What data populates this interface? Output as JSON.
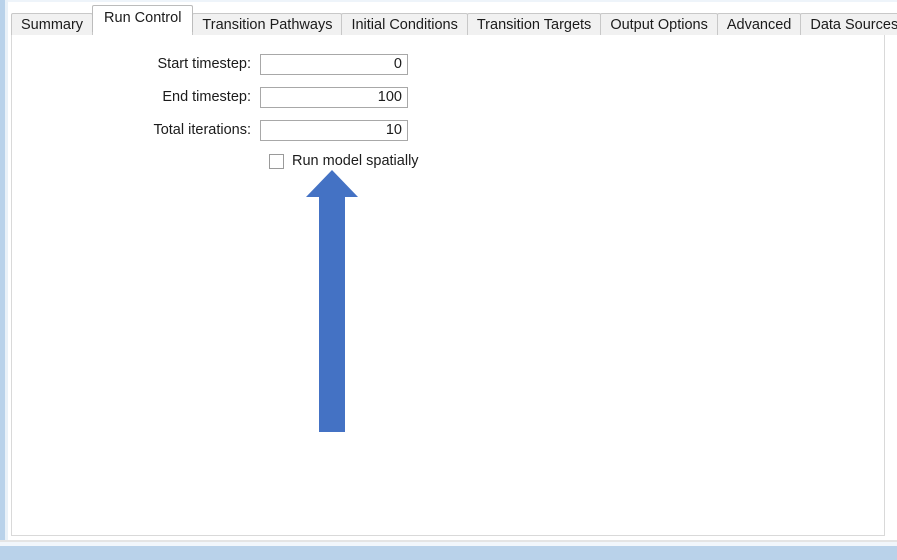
{
  "window": {
    "chrome_color": "#b9d2ea",
    "background": "#ffffff"
  },
  "tabs": {
    "selected": "Run Control",
    "items": [
      {
        "label": "Summary",
        "selected": false
      },
      {
        "label": "Run Control",
        "selected": true
      },
      {
        "label": "Transition Pathways",
        "selected": false
      },
      {
        "label": "Initial Conditions",
        "selected": false
      },
      {
        "label": "Transition Targets",
        "selected": false
      },
      {
        "label": "Output Options",
        "selected": false
      },
      {
        "label": "Advanced",
        "selected": false
      },
      {
        "label": "Data Sources",
        "selected": false
      }
    ]
  },
  "run_control": {
    "fields": [
      {
        "label": "Start timestep:",
        "value": "0",
        "placeholder": ""
      },
      {
        "label": "End timestep:",
        "value": "100",
        "placeholder": ""
      },
      {
        "label": "Total iterations:",
        "value": "10",
        "placeholder": ""
      }
    ],
    "checkbox": {
      "label": "Run model spatially",
      "checked": false
    }
  },
  "annotation": {
    "arrow": {
      "icon": "arrow-up-icon",
      "direction": "up",
      "color": "#4472c4",
      "points_to": "Run model spatially"
    }
  }
}
